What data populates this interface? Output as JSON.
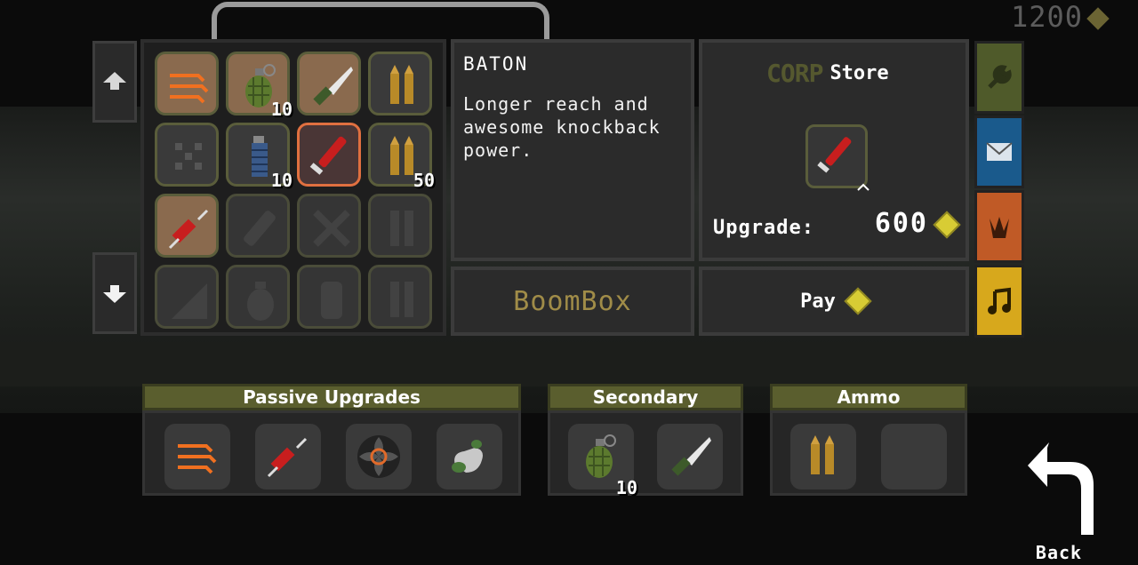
{
  "currency": {
    "amount": "1200",
    "icon": "coin-icon"
  },
  "nav": {
    "up_icon": "arrow-up-icon",
    "down_icon": "arrow-down-icon"
  },
  "inventory": {
    "slots": [
      {
        "icon": "speed-arrows-icon",
        "count": "",
        "state": "owned"
      },
      {
        "icon": "grenade-icon",
        "count": "10",
        "state": "owned"
      },
      {
        "icon": "knife-icon",
        "count": "",
        "state": "owned"
      },
      {
        "icon": "ammo-icon",
        "count": "",
        "state": "normal"
      },
      {
        "icon": "shuriken-icon",
        "count": "",
        "state": "normal"
      },
      {
        "icon": "frag-grenade-icon",
        "count": "10",
        "state": "normal"
      },
      {
        "icon": "baton-icon",
        "count": "",
        "state": "selected"
      },
      {
        "icon": "ammo-icon",
        "count": "50",
        "state": "normal"
      },
      {
        "icon": "syringe-icon",
        "count": "",
        "state": "owned"
      },
      {
        "icon": "locked-item-icon",
        "count": "",
        "state": "locked"
      },
      {
        "icon": "locked-item-icon",
        "count": "",
        "state": "locked"
      },
      {
        "icon": "locked-item-icon",
        "count": "",
        "state": "locked"
      },
      {
        "icon": "locked-item-icon",
        "count": "",
        "state": "locked"
      },
      {
        "icon": "locked-item-icon",
        "count": "",
        "state": "locked"
      },
      {
        "icon": "locked-item-icon",
        "count": "",
        "state": "locked"
      },
      {
        "icon": "locked-item-icon",
        "count": "",
        "state": "locked"
      }
    ]
  },
  "description": {
    "title": "BATON",
    "text": "Longer reach and awesome knockback power."
  },
  "store": {
    "brand": "CORP",
    "label": "Store",
    "item_icon": "baton-icon",
    "upgrade_label": "Upgrade:",
    "upgrade_price": "600"
  },
  "buttons": {
    "boombox": "BoomBox",
    "pay": "Pay"
  },
  "side_tabs": [
    {
      "icon": "wrench-icon",
      "color": "#4f5a2a"
    },
    {
      "icon": "mail-icon",
      "color": "#1a5a8c"
    },
    {
      "icon": "claw-icon",
      "color": "#c05a26"
    },
    {
      "icon": "music-icon",
      "color": "#d7a81c"
    }
  ],
  "equipped": {
    "passive": {
      "title": "Passive Upgrades",
      "items": [
        "speed-arrows-icon",
        "syringe-icon",
        "target-fan-icon",
        "fist-icon"
      ]
    },
    "secondary": {
      "title": "Secondary",
      "items": [
        {
          "icon": "grenade-icon",
          "count": "10"
        },
        {
          "icon": "knife-icon",
          "count": ""
        }
      ]
    },
    "ammo": {
      "title": "Ammo",
      "items": [
        "ammo-icon",
        ""
      ]
    }
  },
  "back": {
    "label": "Back"
  },
  "colors": {
    "accent_green": "#5a5e2e",
    "gold": "#d8cc34",
    "selected": "#e07040"
  }
}
